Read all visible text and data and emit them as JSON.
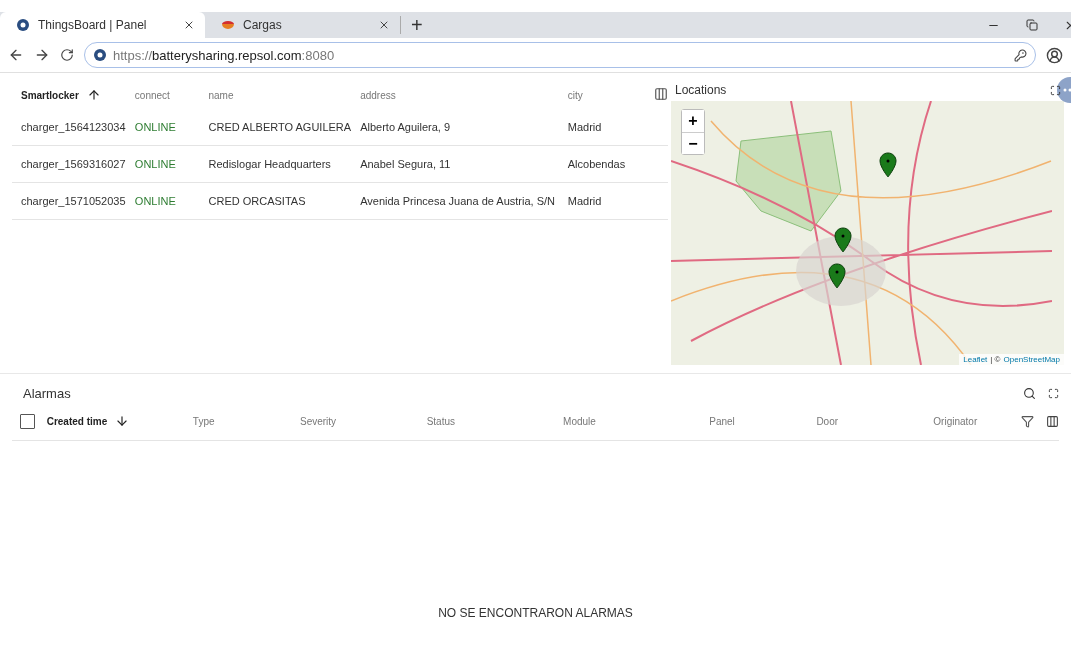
{
  "browser": {
    "tabs": [
      {
        "title": "ThingsBoard | Panel",
        "selected": true
      },
      {
        "title": "Cargas",
        "selected": false
      }
    ],
    "new_tab": "+",
    "url": {
      "scheme": "https://",
      "host": "batterysharing.repsol.com",
      "port": ":8080"
    }
  },
  "devices": {
    "columns": [
      {
        "label": "Smartlocker",
        "sorted": true,
        "ascending": true
      },
      {
        "label": "connect",
        "sorted": false
      },
      {
        "label": "name",
        "sorted": false
      },
      {
        "label": "address",
        "sorted": false
      },
      {
        "label": "city",
        "sorted": false
      }
    ],
    "rows": [
      [
        "charger_1564123034",
        "ONLINE",
        "CRED ALBERTO AGUILERA",
        "Alberto Aguilera, 9",
        "Madrid"
      ],
      [
        "charger_1569316027",
        "ONLINE",
        "Redislogar Headquarters",
        "Anabel Segura, 11",
        "Alcobendas"
      ],
      [
        "charger_1571052035",
        "ONLINE",
        "CRED ORCASITAS",
        "Avenida Princesa Juana de Austria, S/N",
        "Madrid"
      ]
    ]
  },
  "map": {
    "title": "Locations",
    "zoom_in": "+",
    "zoom_out": "−",
    "attribution": {
      "leaflet": "Leaflet",
      "separator": "| ©",
      "osm": "OpenStreetMap"
    }
  },
  "alarms": {
    "title": "Alarmas",
    "select_all": {
      "checked": false
    },
    "columns": [
      {
        "label": "Created time",
        "sorted": true,
        "ascending": false
      },
      {
        "label": "Type",
        "sorted": false
      },
      {
        "label": "Severity",
        "sorted": false
      },
      {
        "label": "Status",
        "sorted": false
      },
      {
        "label": "Module",
        "sorted": false
      },
      {
        "label": "Panel",
        "sorted": false
      },
      {
        "label": "Door",
        "sorted": false
      },
      {
        "label": "Originator",
        "sorted": false
      }
    ],
    "empty_message": "NO SE ENCONTRARON ALARMAS"
  }
}
